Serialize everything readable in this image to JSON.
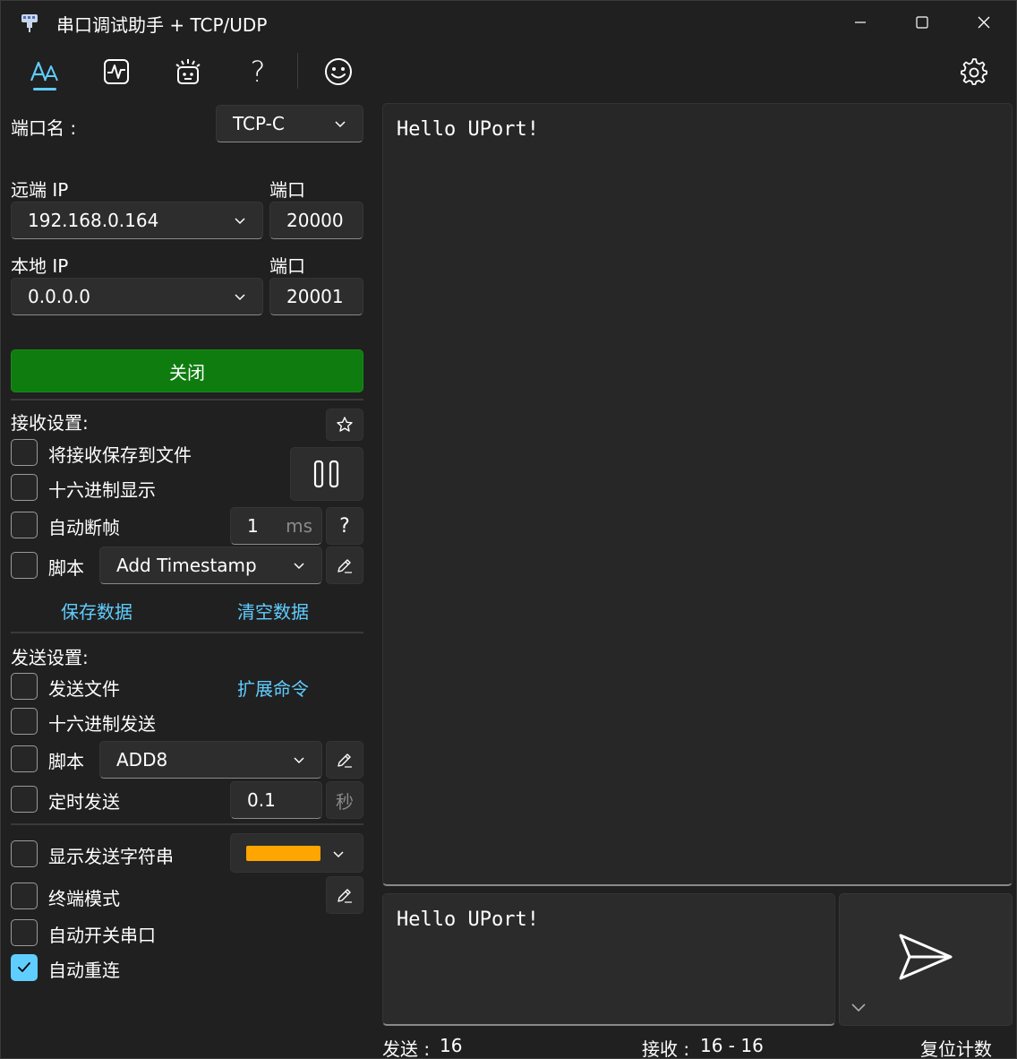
{
  "window": {
    "title": "串口调试助手 + TCP/UDP"
  },
  "toolbar": {
    "items": [
      {
        "name": "font-icon"
      },
      {
        "name": "waveform-icon"
      },
      {
        "name": "effects-icon"
      },
      {
        "name": "help-icon",
        "glyph": "?"
      },
      {
        "name": "emoji-icon"
      }
    ],
    "accent": "#60cdff"
  },
  "connection": {
    "port_name_label": "端口名 :",
    "port_name_value": "TCP-C",
    "remote_ip_label": "远端 IP",
    "remote_ip_value": "192.168.0.164",
    "remote_port_label": "端口",
    "remote_port_value": "20000",
    "local_ip_label": "本地 IP",
    "local_ip_value": "0.0.0.0",
    "local_port_label": "端口",
    "local_port_value": "20001",
    "toggle_button_label": "关闭",
    "toggle_button_color": "#0e7c0e"
  },
  "receive_settings": {
    "header": "接收设置:",
    "save_to_file_label": "将接收保存到文件",
    "hex_display_label": "十六进制显示",
    "auto_frame_label": "自动断帧",
    "auto_frame_value": "1",
    "auto_frame_unit": "ms",
    "help_glyph": "?",
    "script_label": "脚本",
    "script_value": "Add Timestamp",
    "save_data_link": "保存数据",
    "clear_data_link": "清空数据"
  },
  "send_settings": {
    "header": "发送设置:",
    "send_file_label": "发送文件",
    "extend_command_link": "扩展命令",
    "hex_send_label": "十六进制发送",
    "script_label": "脚本",
    "script_value": "ADD8",
    "timed_send_label": "定时发送",
    "timed_send_value": "0.1",
    "timed_send_unit": "秒"
  },
  "display_settings": {
    "show_send_string_label": "显示发送字符串",
    "send_string_color": "#ffa500",
    "terminal_mode_label": "终端模式",
    "auto_open_close_label": "自动开关串口",
    "auto_reconnect_label": "自动重连",
    "auto_reconnect_checked": true
  },
  "receive_area": {
    "content": "Hello UPort!"
  },
  "send_area": {
    "content": "Hello UPort!"
  },
  "status_bar": {
    "sent_label": "发送 :",
    "sent_value": "16",
    "received_label": "接收 :",
    "received_value": "16  -  16",
    "reset_counter_link": "复位计数"
  }
}
